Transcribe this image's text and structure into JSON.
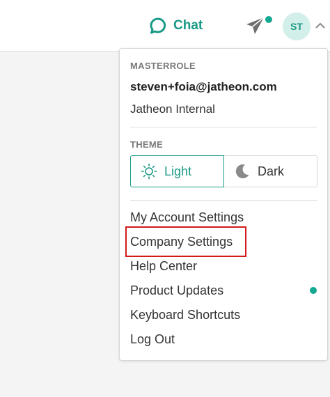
{
  "header": {
    "chat_label": "Chat",
    "avatar_initials": "ST"
  },
  "account_menu": {
    "role_heading": "MASTERROLE",
    "email": "steven+foia@jatheon.com",
    "organization": "Jatheon Internal",
    "theme": {
      "heading": "THEME",
      "light_label": "Light",
      "dark_label": "Dark",
      "selected": "light"
    },
    "items": [
      {
        "label": "My Account Settings"
      },
      {
        "label": "Company Settings"
      },
      {
        "label": "Help Center"
      },
      {
        "label": "Product Updates"
      },
      {
        "label": "Keyboard Shortcuts"
      },
      {
        "label": "Log Out"
      }
    ]
  },
  "colors": {
    "accent": "#1a9a86",
    "notification_dot": "#14a891",
    "highlight": "#d11a1a"
  }
}
